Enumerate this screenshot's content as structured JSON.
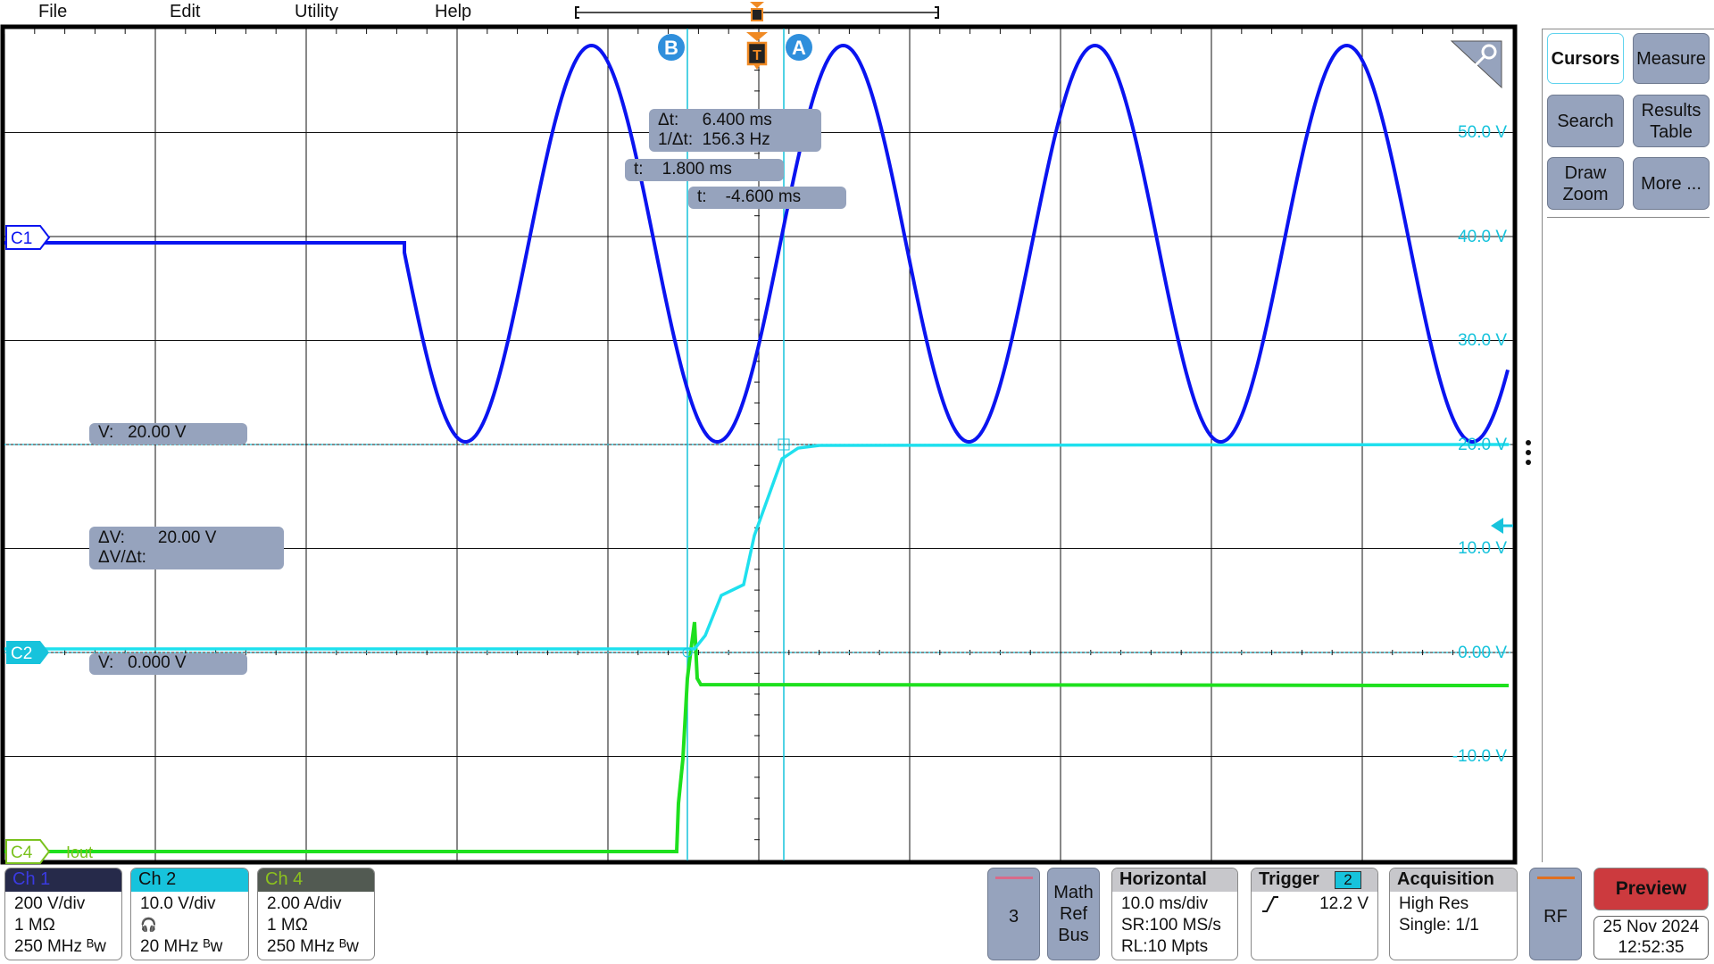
{
  "menu": {
    "items": [
      "File",
      "Edit",
      "Utility",
      "Help"
    ]
  },
  "plot": {
    "cursor_b_label": "B",
    "cursor_a_label": "A",
    "trigger_marker": "T",
    "readouts": {
      "delta_t": "Δt:     6.400 ms",
      "inv_delta_t": "1/Δt:  156.3 Hz",
      "t_a": "t:    1.800 ms",
      "t_b": "t:    -4.600 ms",
      "v_a": "V:   20.00 V",
      "v_b": "V:   0.000 V",
      "delta_v": "ΔV:       20.00 V",
      "dv_dt": "ΔV/Δt:"
    },
    "volt_labels": [
      "50.0 V",
      "40.0 V",
      "30.0 V",
      "20.0 V",
      "10.0 V",
      "0.00 V",
      "-10.0 V"
    ],
    "channel_badges": {
      "c1": "C1",
      "c2": "C2",
      "c4": "C4",
      "c4_name": "Iout"
    },
    "colors": {
      "ch1": "#0a14f0",
      "ch2": "#1fe0ee",
      "ch4": "#1ee01e",
      "cursor": "#17c3dc",
      "trigger": "#f08a24"
    }
  },
  "side": {
    "buttons": [
      "Cursors",
      "Measure",
      "Search",
      "Results\nTable",
      "Draw\nZoom",
      "More ..."
    ]
  },
  "bottom": {
    "ch1": {
      "title": "Ch 1",
      "lines": [
        "200 V/div",
        "1 MΩ",
        "250 MHz ᴮw"
      ]
    },
    "ch2": {
      "title": "Ch 2",
      "lines": [
        "10.0 V/div",
        "🎧",
        "20 MHz ᴮw"
      ]
    },
    "ch4": {
      "title": "Ch 4",
      "lines": [
        "2.00 A/div",
        "1 MΩ",
        "250 MHz ᴮw"
      ]
    },
    "add_channel": "3",
    "math_ref_bus": [
      "Math",
      "Ref",
      "Bus"
    ],
    "horizontal": {
      "title": "Horizontal",
      "lines": [
        "10.0 ms/div",
        "SR:100 MS/s",
        "RL:10 Mpts"
      ]
    },
    "trigger": {
      "title": "Trigger",
      "source": "2",
      "slope_icon": "rising-edge-icon",
      "level": "12.2 V"
    },
    "acquisition": {
      "title": "Acquisition",
      "lines": [
        "High Res",
        "Single: 1/1"
      ]
    },
    "rf": "RF",
    "preview": "Preview",
    "date": "25 Nov 2024",
    "time": "12:52:35"
  }
}
